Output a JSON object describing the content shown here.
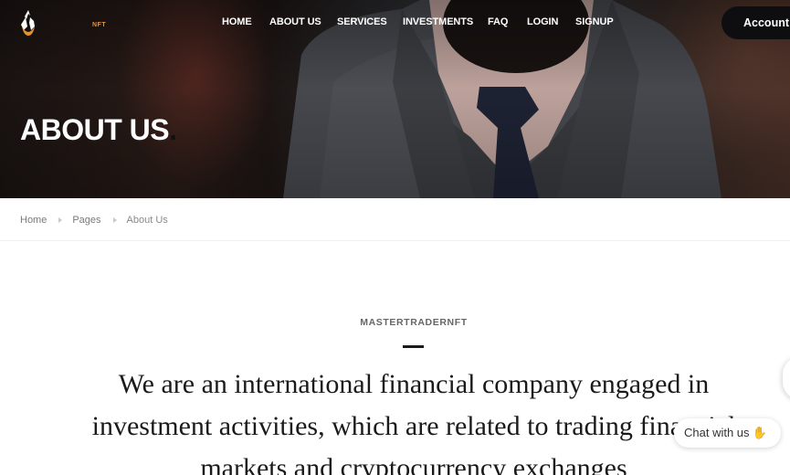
{
  "brand": {
    "name": "NFT",
    "logo_icon": "flame-logo-icon",
    "accent": "#e8912c"
  },
  "nav": {
    "items": [
      "HOME",
      "ABOUT US",
      "SERVICES",
      "INVESTMENTS",
      "FAQ",
      "LOGIN",
      "SIGNUP"
    ],
    "account_label": "Account"
  },
  "hero": {
    "title": "ABOUT US",
    "title_suffix": "."
  },
  "breadcrumb": {
    "items": [
      "Home",
      "Pages"
    ],
    "current": "About Us"
  },
  "content": {
    "kicker": "MASTERTRADERNFT",
    "statement": "We are an international financial company engaged in investment activities, which are related to trading financial markets and cryptocurrency exchanges"
  },
  "chat": {
    "label": "Chat with us",
    "icon": "waving-hand-icon"
  }
}
